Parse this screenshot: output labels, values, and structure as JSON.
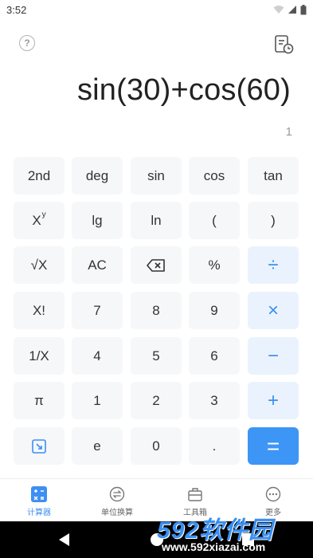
{
  "status_bar": {
    "time": "3:52"
  },
  "display": {
    "expression": "sin(30)+cos(60)",
    "result": "1"
  },
  "keypad": {
    "rows": [
      [
        {
          "label": "2nd",
          "type": "fn"
        },
        {
          "label": "deg",
          "type": "fn"
        },
        {
          "label": "sin",
          "type": "fn"
        },
        {
          "label": "cos",
          "type": "fn"
        },
        {
          "label": "tan",
          "type": "fn"
        }
      ],
      [
        {
          "label": "X",
          "sup": "y",
          "type": "fn"
        },
        {
          "label": "lg",
          "type": "fn"
        },
        {
          "label": "ln",
          "type": "fn"
        },
        {
          "label": "(",
          "type": "fn"
        },
        {
          "label": ")",
          "type": "fn"
        }
      ],
      [
        {
          "label": "√X",
          "type": "fn"
        },
        {
          "label": "AC",
          "type": "fn"
        },
        {
          "label": "",
          "icon": "backspace-icon",
          "type": "fn"
        },
        {
          "label": "%",
          "type": "fn"
        },
        {
          "label": "÷",
          "type": "op"
        }
      ],
      [
        {
          "label": "X!",
          "type": "fn"
        },
        {
          "label": "7",
          "type": "num"
        },
        {
          "label": "8",
          "type": "num"
        },
        {
          "label": "9",
          "type": "num"
        },
        {
          "label": "×",
          "type": "op"
        }
      ],
      [
        {
          "label": "1/X",
          "type": "fn"
        },
        {
          "label": "4",
          "type": "num"
        },
        {
          "label": "5",
          "type": "num"
        },
        {
          "label": "6",
          "type": "num"
        },
        {
          "label": "−",
          "type": "op"
        }
      ],
      [
        {
          "label": "π",
          "type": "fn"
        },
        {
          "label": "1",
          "type": "num"
        },
        {
          "label": "2",
          "type": "num"
        },
        {
          "label": "3",
          "type": "num"
        },
        {
          "label": "+",
          "type": "op"
        }
      ],
      [
        {
          "label": "",
          "icon": "collapse-icon",
          "type": "fn"
        },
        {
          "label": "e",
          "type": "num"
        },
        {
          "label": "0",
          "type": "num"
        },
        {
          "label": ".",
          "type": "num"
        },
        {
          "label": "=",
          "type": "eq"
        }
      ]
    ]
  },
  "bottom_nav": {
    "items": [
      {
        "label": "计算器",
        "icon": "calculator-icon",
        "active": true
      },
      {
        "label": "单位换算",
        "icon": "unit-convert-icon",
        "active": false
      },
      {
        "label": "工具箱",
        "icon": "toolbox-icon",
        "active": false
      },
      {
        "label": "更多",
        "icon": "more-icon",
        "active": false
      }
    ]
  },
  "watermark": {
    "brand": "592软件园",
    "url": "www.592xiazai.com"
  },
  "colors": {
    "accent": "#3d8ff2",
    "key_bg": "#f6f7f9",
    "op_bg": "#eaf3fd",
    "equals_bg": "#3d95f5"
  }
}
